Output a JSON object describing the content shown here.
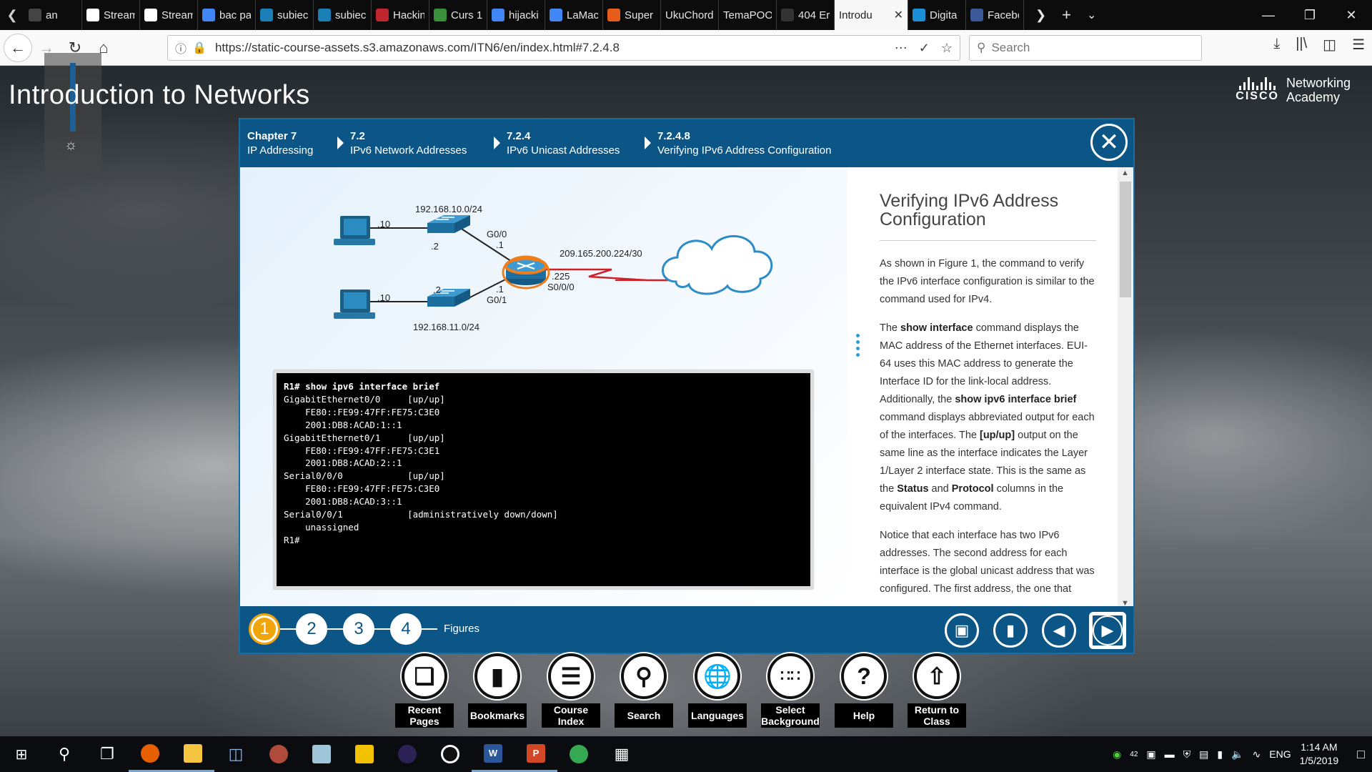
{
  "browser": {
    "tabs": [
      {
        "title": "an",
        "icon": "arrow-left-icon",
        "color": "#444444"
      },
      {
        "title": "Stream",
        "icon": "wikipedia-icon",
        "color": "#ffffff"
      },
      {
        "title": "Stream",
        "icon": "wikipedia-icon",
        "color": "#ffffff"
      },
      {
        "title": "bac pa",
        "icon": "google-icon",
        "color": "#4285f4"
      },
      {
        "title": "subiec",
        "icon": "shazam-icon",
        "color": "#1a7fb5"
      },
      {
        "title": "subiec",
        "icon": "shazam-icon",
        "color": "#1a7fb5"
      },
      {
        "title": "Hackin",
        "icon": "hacking-icon",
        "color": "#c0262d"
      },
      {
        "title": "Curs 1",
        "icon": "notebook-icon",
        "color": "#3a8f3a"
      },
      {
        "title": "hijacki",
        "icon": "google-icon",
        "color": "#4285f4"
      },
      {
        "title": "LaMac",
        "icon": "google-icon",
        "color": "#4285f4"
      },
      {
        "title": "Super",
        "icon": "super-icon",
        "color": "#e85c1a"
      },
      {
        "title": "UkuChords",
        "icon": "",
        "color": ""
      },
      {
        "title": "TemaPOO",
        "icon": "",
        "color": ""
      },
      {
        "title": "404 Er",
        "icon": "error-icon",
        "color": "#333333"
      },
      {
        "title": "Introdu",
        "icon": "",
        "color": "",
        "active": true
      },
      {
        "title": "Digita",
        "icon": "cisco-icon",
        "color": "#1b8fd6"
      },
      {
        "title": "Facebo",
        "icon": "facebook-icon",
        "color": "#3b5998"
      }
    ],
    "url": "https://static-course-assets.s3.amazonaws.com/ITN6/en/index.html#7.2.4.8",
    "search_placeholder": "Search"
  },
  "course": {
    "title": "Introduction to Networks",
    "logo_word": "CISCO",
    "logo_line1": "Networking",
    "logo_line2": "Academy"
  },
  "breadcrumbs": [
    {
      "num": "Chapter 7",
      "label": "IP Addressing"
    },
    {
      "num": "7.2",
      "label": "IPv6 Network Addresses"
    },
    {
      "num": "7.2.4",
      "label": "IPv6 Unicast Addresses"
    },
    {
      "num": "7.2.4.8",
      "label": "Verifying IPv6 Address Configuration"
    }
  ],
  "topology": {
    "net1": "192.168.10.0/24",
    "net2": "192.168.11.0/24",
    "wan": "209.165.200.224/30",
    "pc1_host": ".10",
    "pc2_host": ".10",
    "sw1_host": ".2",
    "sw2_host": ".2",
    "g00": "G0/0",
    "g00_host": ".1",
    "g01": "G0/1",
    "g01_host": ".1",
    "s000": "S0/0/0",
    "s000_host": ".225"
  },
  "terminal": {
    "prompt": "R1# ",
    "command": "show ipv6 interface brief",
    "lines": [
      "GigabitEthernet0/0     [up/up]",
      "    FE80::FE99:47FF:FE75:C3E0",
      "    2001:DB8:ACAD:1::1",
      "GigabitEthernet0/1     [up/up]",
      "    FE80::FE99:47FF:FE75:C3E1",
      "    2001:DB8:ACAD:2::1",
      "Serial0/0/0            [up/up]",
      "    FE80::FE99:47FF:FE75:C3E0",
      "    2001:DB8:ACAD:3::1",
      "Serial0/0/1            [administratively down/down]",
      "    unassigned",
      "R1#"
    ]
  },
  "article": {
    "heading": "Verifying IPv6 Address Configuration",
    "p1": "As shown in Figure 1, the command to verify the IPv6 interface configuration is similar to the command used for IPv4.",
    "p2_a": "The ",
    "p2_b1": "show interface",
    "p2_c": " command displays the MAC address of the Ethernet interfaces. EUI-64 uses this MAC address to generate the Interface ID for the link-local address. Additionally, the ",
    "p2_b2": "show ipv6 interface brief",
    "p2_d": " command displays abbreviated output for each of the interfaces. The ",
    "p2_b3": "[up/up]",
    "p2_e": " output on the same line as the interface indicates the Layer 1/Layer 2 interface state. This is the same as the ",
    "p2_b4": "Status",
    "p2_f": " and ",
    "p2_b5": "Protocol",
    "p2_g": " columns in the equivalent IPv4 command.",
    "p3": "Notice that each interface has two IPv6 addresses. The second address for each interface is the global unicast address that was configured. The first address, the one that"
  },
  "figures": {
    "items": [
      "1",
      "2",
      "3",
      "4"
    ],
    "active": "1",
    "label": "Figures"
  },
  "toolbar": [
    {
      "label": "Recent Pages",
      "icon": "recent-pages-icon"
    },
    {
      "label": "Bookmarks",
      "icon": "bookmark-icon"
    },
    {
      "label": "Course Index",
      "icon": "menu-icon"
    },
    {
      "label": "Search",
      "icon": "search-icon"
    },
    {
      "label": "Languages",
      "icon": "globe-icon"
    },
    {
      "label": "Select Background",
      "icon": "grid-icon"
    },
    {
      "label": "Help",
      "icon": "help-icon"
    },
    {
      "label": "Return to Class",
      "icon": "arrow-up-icon"
    }
  ],
  "taskbar": {
    "time": "1:14 AM",
    "date": "1/5/2019",
    "lang": "ENG",
    "badge": "42"
  }
}
